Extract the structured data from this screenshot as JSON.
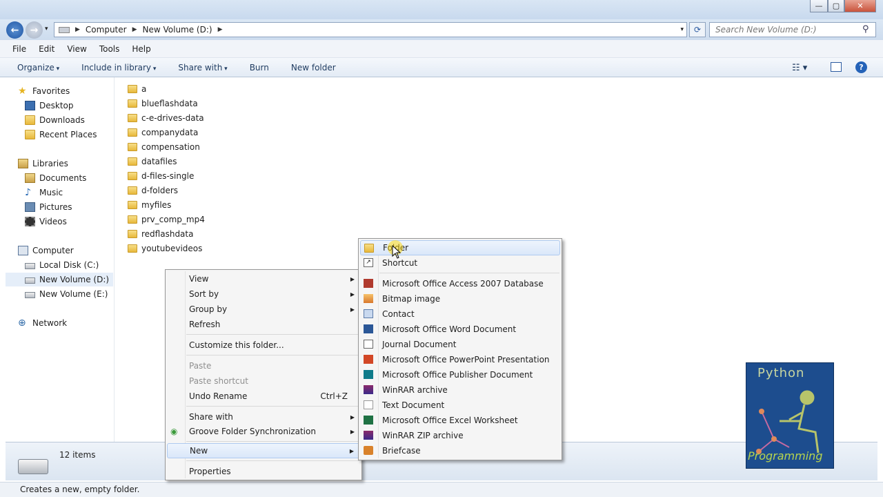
{
  "window": {
    "title": "Python Programming",
    "controls": [
      "—",
      "▢",
      "✕"
    ]
  },
  "address": {
    "segments": [
      "Computer",
      "New Volume (D:)"
    ],
    "search_placeholder": "Search New Volume (D:)"
  },
  "menubar": [
    "File",
    "Edit",
    "View",
    "Tools",
    "Help"
  ],
  "toolbar": {
    "organize": "Organize",
    "include": "Include in library",
    "share": "Share with",
    "burn": "Burn",
    "newfolder": "New folder"
  },
  "nav": {
    "favorites": "Favorites",
    "desktop": "Desktop",
    "downloads": "Downloads",
    "recent": "Recent Places",
    "libraries": "Libraries",
    "documents": "Documents",
    "music": "Music",
    "pictures": "Pictures",
    "videos": "Videos",
    "computer": "Computer",
    "localc": "Local Disk (C:)",
    "newd": "New Volume (D:)",
    "newe": "New Volume (E:)",
    "network": "Network"
  },
  "files": [
    "a",
    "blueflashdata",
    "c-e-drives-data",
    "companydata",
    "compensation",
    "datafiles",
    "d-files-single",
    "d-folders",
    "myfiles",
    "prv_comp_mp4",
    "redflashdata",
    "youtubevideos"
  ],
  "status": {
    "count": "12 items",
    "hint": "Creates a new, empty folder."
  },
  "context_menu": {
    "view": "View",
    "sortby": "Sort by",
    "groupby": "Group by",
    "refresh": "Refresh",
    "customize": "Customize this folder...",
    "paste": "Paste",
    "pasteshortcut": "Paste shortcut",
    "undo": "Undo Rename",
    "undo_key": "Ctrl+Z",
    "sharewith": "Share with",
    "groove": "Groove Folder Synchronization",
    "new": "New",
    "properties": "Properties"
  },
  "new_submenu": {
    "folder": "Folder",
    "shortcut": "Shortcut",
    "access": "Microsoft Office Access 2007 Database",
    "bitmap": "Bitmap image",
    "contact": "Contact",
    "word": "Microsoft Office Word Document",
    "journal": "Journal Document",
    "ppt": "Microsoft Office PowerPoint Presentation",
    "publisher": "Microsoft Office Publisher Document",
    "winrar": "WinRAR archive",
    "text": "Text Document",
    "excel": "Microsoft Office Excel Worksheet",
    "winzip": "WinRAR ZIP archive",
    "briefcase": "Briefcase"
  },
  "logo": {
    "line1": "Python",
    "line2": "Programming"
  }
}
